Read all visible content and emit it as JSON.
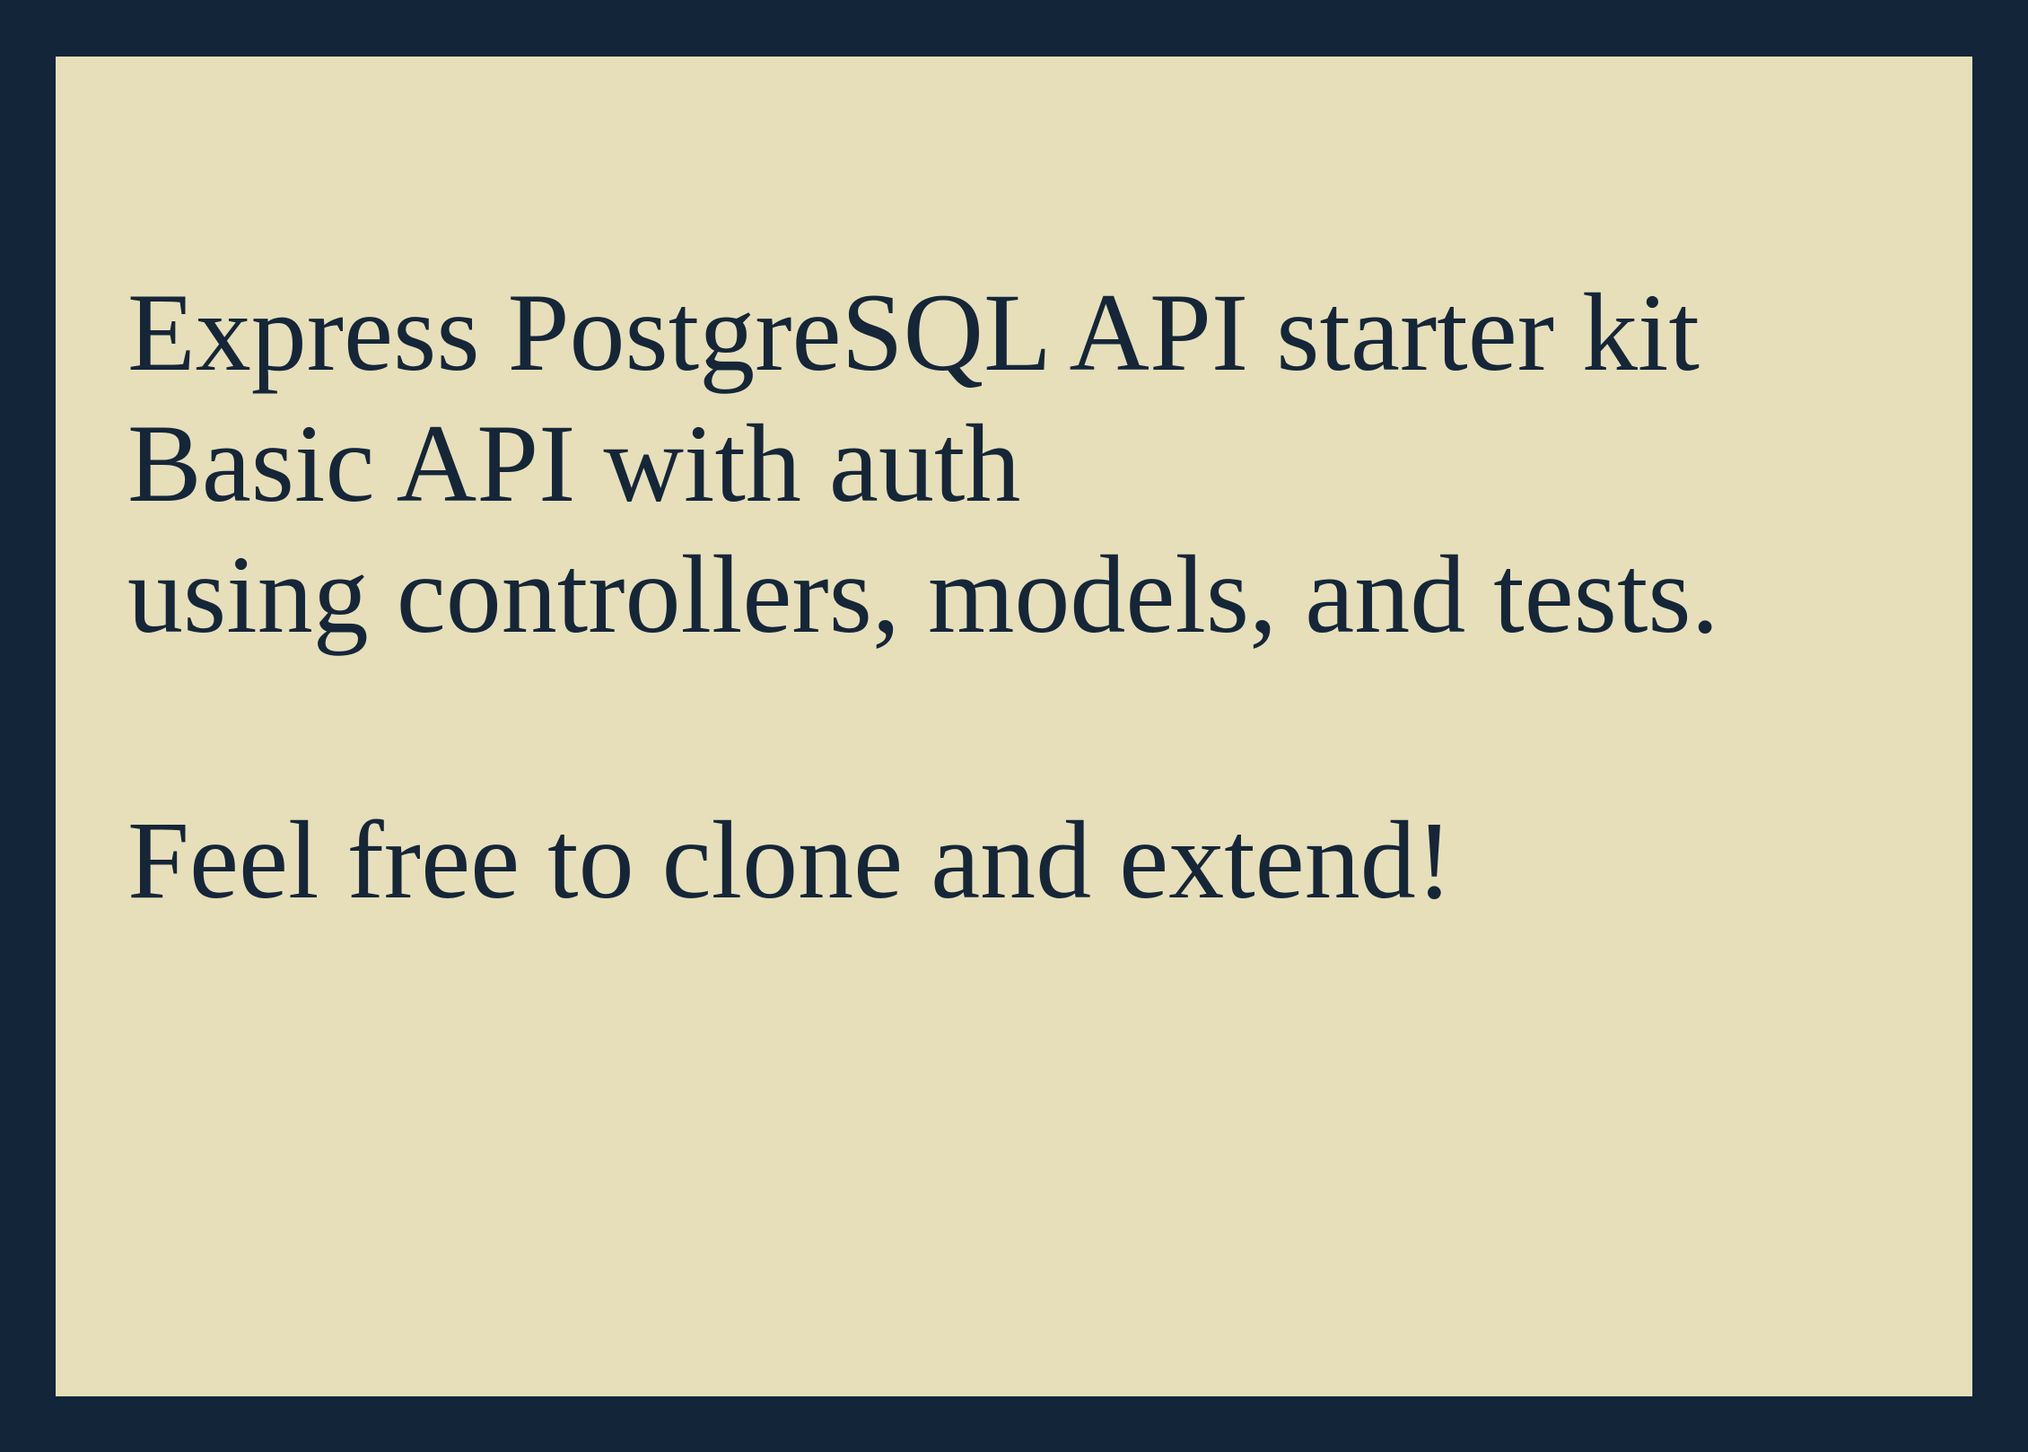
{
  "colors": {
    "frame": "#132539",
    "card": "#e6dfba",
    "text": "#152638"
  },
  "text": {
    "line1": "Express PostgreSQL API starter kit",
    "line2": "Basic API with auth",
    "line3": "using controllers, models, and tests.",
    "line4": "Feel free to clone and extend!"
  }
}
